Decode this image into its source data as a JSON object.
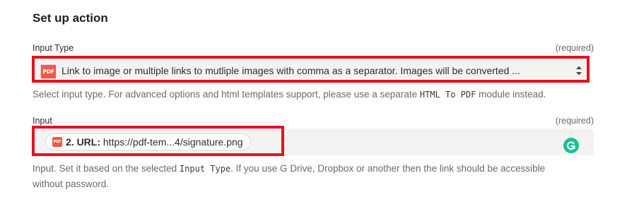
{
  "section_title": "Set up action",
  "input_type_field": {
    "label": "Input Type",
    "required": "(required)",
    "icon": "pdf-file-icon",
    "value": "Link to image or multiple links to mutliple images with comma as a separator. Images will be converted ...",
    "help_prefix": "Select input type. For advanced options and html templates support, please use a separate",
    "help_code": "HTML To PDF",
    "help_suffix": "module instead."
  },
  "input_field": {
    "label": "Input",
    "required": "(required)",
    "pill": {
      "icon": "pdf-file-icon",
      "step_label": "2. URL:",
      "value": "https://pdf-tem...4/signature.png"
    },
    "assistant_icon": "grammarly-icon",
    "help_prefix": "Input. Set it based on the selected",
    "help_code": "Input Type",
    "help_line1_suffix": ". If you use G Drive, Dropbox or another then the link should be accessible",
    "help_line2": "without password."
  },
  "colors": {
    "highlight": "#e0141f",
    "field_bg": "#f4f3f1",
    "pdf_icon": "#f2584a",
    "grammarly": "#15c39a"
  }
}
